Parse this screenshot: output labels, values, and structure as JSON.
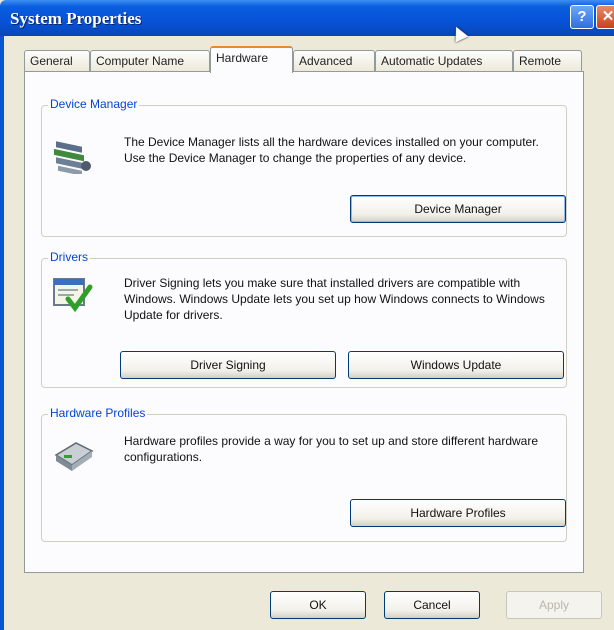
{
  "window": {
    "title": "System Properties",
    "help_glyph": "?",
    "close_glyph": "✕"
  },
  "tabs": [
    {
      "label": "General"
    },
    {
      "label": "Computer Name"
    },
    {
      "label": "Hardware",
      "active": true
    },
    {
      "label": "Advanced"
    },
    {
      "label": "Automatic Updates"
    },
    {
      "label": "Remote"
    }
  ],
  "device_manager": {
    "legend": "Device Manager",
    "icon": "device-manager-icon",
    "description": "The Device Manager lists all the hardware devices installed on your computer. Use the Device Manager to change the properties of any device.",
    "button": "Device Manager"
  },
  "drivers": {
    "legend": "Drivers",
    "icon": "driver-signing-icon",
    "description": "Driver Signing lets you make sure that installed drivers are compatible with Windows. Windows Update lets you set up how Windows connects to Windows Update for drivers.",
    "button_signing": "Driver Signing",
    "button_update": "Windows Update"
  },
  "hardware_profiles": {
    "legend": "Hardware Profiles",
    "icon": "hardware-profiles-icon",
    "description": "Hardware profiles provide a way for you to set up and store different hardware configurations.",
    "button": "Hardware Profiles"
  },
  "footer": {
    "ok": "OK",
    "cancel": "Cancel",
    "apply": "Apply"
  },
  "colors": {
    "titlebar": "#0752d6",
    "legend_text": "#0046d5",
    "dialog_bg": "#ece9d8",
    "active_tab_accent": "#e68b2c"
  }
}
